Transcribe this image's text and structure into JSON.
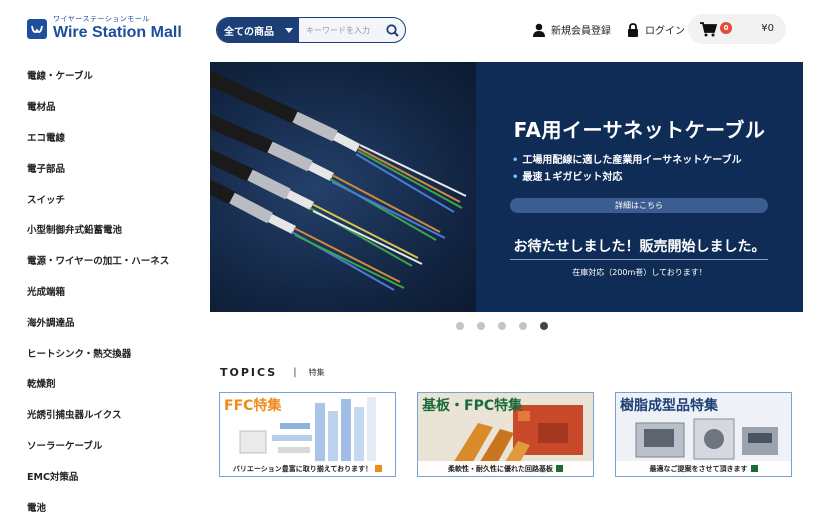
{
  "header": {
    "logo_kana": "ワイヤーステーションモール",
    "logo_name": "Wire Station Mall",
    "search_category": "全ての商品",
    "search_placeholder": "キーワードを入力",
    "register_label": "新規会員登録",
    "login_label": "ログイン",
    "cart_count": "0",
    "cart_total": "¥0"
  },
  "sidebar": {
    "items": [
      {
        "label": "電線・ケーブル"
      },
      {
        "label": "電材品"
      },
      {
        "label": "エコ電線"
      },
      {
        "label": "電子部品"
      },
      {
        "label": "スイッチ"
      },
      {
        "label": "小型制御弁式鉛蓄電池"
      },
      {
        "label": "電源・ワイヤーの加工・ハーネス"
      },
      {
        "label": "光成端箱"
      },
      {
        "label": "海外調達品"
      },
      {
        "label": "ヒートシンク・熱交換器"
      },
      {
        "label": "乾燥剤"
      },
      {
        "label": "光誘引捕虫器ルイクス"
      },
      {
        "label": "ソーラーケーブル"
      },
      {
        "label": "EMC対策品"
      },
      {
        "label": "電池"
      }
    ]
  },
  "banner": {
    "title": "FA用イーサネットケーブル",
    "bullet1": "工場用配線に適した産業用イーサネットケーブル",
    "bullet2": "最速１ギガビット対応",
    "detail_button": "詳細はこちら",
    "sale_text": "お待たせしました！販売開始しました。",
    "stock_text": "在庫対応（200m巻）しております！",
    "slide_count": 5,
    "active_slide": 5
  },
  "topics": {
    "title": "TOPICS",
    "separator": "|",
    "subtitle": "特集",
    "cards": [
      {
        "title": "FFC特集",
        "caption": "バリエーション豊富に取り揃えております！"
      },
      {
        "title": "基板・FPC特集",
        "caption": "柔軟性・耐久性に優れた回路基板"
      },
      {
        "title": "樹脂成型品特集",
        "caption": "最適なご提案をさせて頂きます"
      }
    ]
  },
  "colors": {
    "brand": "#1f4e9e",
    "search_dark": "#1c3f77",
    "banner_bg": "#0f2c56",
    "accent_orange": "#f08a1c",
    "badge_red": "#e34b3a"
  }
}
